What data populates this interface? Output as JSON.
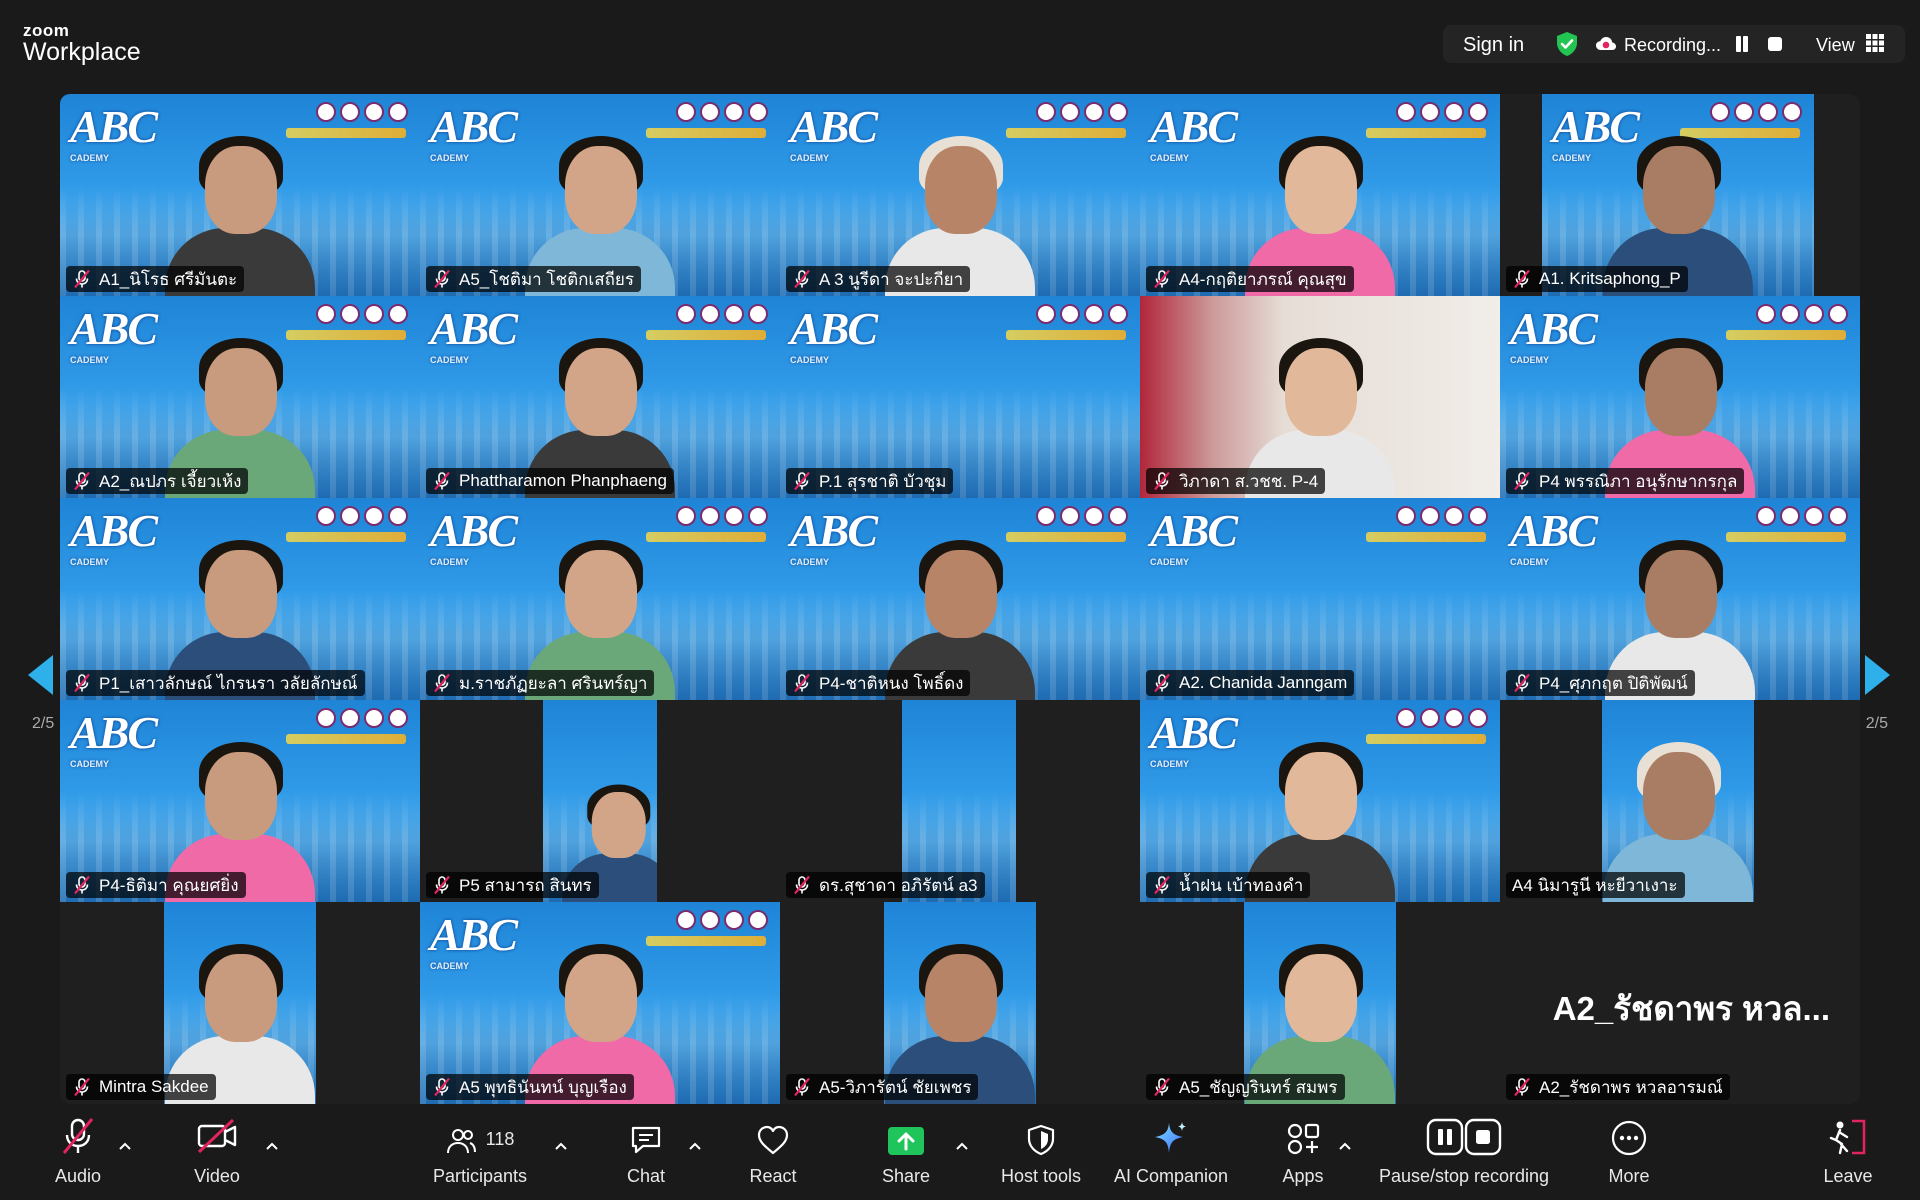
{
  "app": {
    "brand_top": "zoom",
    "brand_bottom": "Workplace"
  },
  "header": {
    "sign_in": "Sign in",
    "recording_label": "Recording...",
    "view_label": "View"
  },
  "gallery": {
    "page_left": "2/5",
    "page_right": "2/5",
    "active_speaker_overlay": "A2_รัชดาพร หวล...",
    "banner_text": "ABC",
    "banner_subtext": "CADEMY",
    "tiles": [
      {
        "name": "A1_นิโรธ ศรีมันตะ",
        "muted": true
      },
      {
        "name": "A5_โชติมา โชติกเสถียร",
        "muted": true
      },
      {
        "name": "A 3 นูรีดา จะปะกียา",
        "muted": true
      },
      {
        "name": "A4-กฤติยาภรณ์ คุณสุข",
        "muted": true
      },
      {
        "name": "A1. Kritsaphong_P",
        "muted": true
      },
      {
        "name": "A2_ณปภร เจี้ยวเห้ง",
        "muted": true
      },
      {
        "name": "Phattharamon Phanphaeng",
        "muted": true
      },
      {
        "name": "P.1 สุรชาติ บัวชุม",
        "muted": true
      },
      {
        "name": "วิภาดา ส.วชช. P-4",
        "muted": true
      },
      {
        "name": "P4 พรรณิภา อนุรักษากรกุล",
        "muted": true
      },
      {
        "name": "P1_เสาวลักษณ์ ไกรนรา วลัยลักษณ์",
        "muted": true
      },
      {
        "name": "ม.ราชภัฏยะลา ศรินทร์ญา",
        "muted": true
      },
      {
        "name": "P4-ชาติหนง โพธิ์ดง",
        "muted": true
      },
      {
        "name": "A2. Chanida Janngam",
        "muted": true
      },
      {
        "name": "P4_ศุภกฤต ปิติพัฒน์",
        "muted": true
      },
      {
        "name": "P4-ธิติมา คุณยศยิ่ง",
        "muted": true
      },
      {
        "name": "P5 สามารถ สินทร",
        "muted": true
      },
      {
        "name": "ดร.สุชาดา อภิรัตน์ a3",
        "muted": true
      },
      {
        "name": "น้ำฝน เบ้าทองคำ",
        "muted": true
      },
      {
        "name": "A4 นิมารูนี หะยีวาเงาะ",
        "muted": false
      },
      {
        "name": "Mintra Sakdee",
        "muted": true
      },
      {
        "name": "A5 พุทธินันทน์ บุญเรือง",
        "muted": true
      },
      {
        "name": "A5-วิภารัตน์ ชัยเพชร",
        "muted": true
      },
      {
        "name": "A5_ชัญญรินทร์ สมพร",
        "muted": true
      },
      {
        "name": "A2_รัชดาพร หวลอารมณ์",
        "muted": true
      }
    ]
  },
  "toolbar": {
    "audio": "Audio",
    "video": "Video",
    "participants": "Participants",
    "participants_count": "118",
    "chat": "Chat",
    "react": "React",
    "share": "Share",
    "host_tools": "Host tools",
    "ai_companion": "AI Companion",
    "apps": "Apps",
    "pause_stop_recording": "Pause/stop recording",
    "more": "More",
    "leave": "Leave"
  },
  "colors": {
    "accent_green": "#23c552",
    "mute_red": "#e0245e",
    "pager_blue": "#2eb0ea",
    "share_green": "#1fc55a",
    "leave_red": "#e0245e"
  }
}
